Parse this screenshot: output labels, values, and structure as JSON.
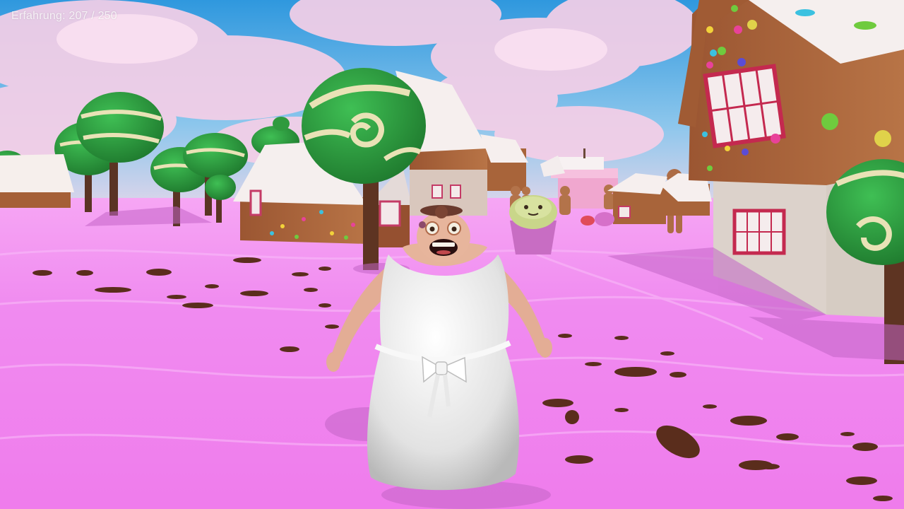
{
  "hud": {
    "experience_label": "Erfahrung:",
    "experience_current": 207,
    "experience_max": 250,
    "experience_text": "Erfahrung: 207 / 250"
  },
  "scene": {
    "name": "candy-village",
    "colors": {
      "sky_top": "#3a9fe0",
      "sky_bottom": "#f3d6ea",
      "cloud": "#f4c9e6",
      "ground": "#f07ff0",
      "ground_light": "#f9a8f9",
      "chocolate": "#5a2d1c",
      "gingerbread": "#a8643a",
      "frosting": "#f4eeee",
      "tree_canopy": "#2f9a3e",
      "tree_swirl": "#e9e2b6",
      "dress": "#f1f1f1",
      "skin": "#e7b59c"
    },
    "entities": [
      "character-grandma",
      "gingerbread-house",
      "lollipop-tree",
      "cupcake",
      "gingerbread-man",
      "cake-tower"
    ]
  }
}
